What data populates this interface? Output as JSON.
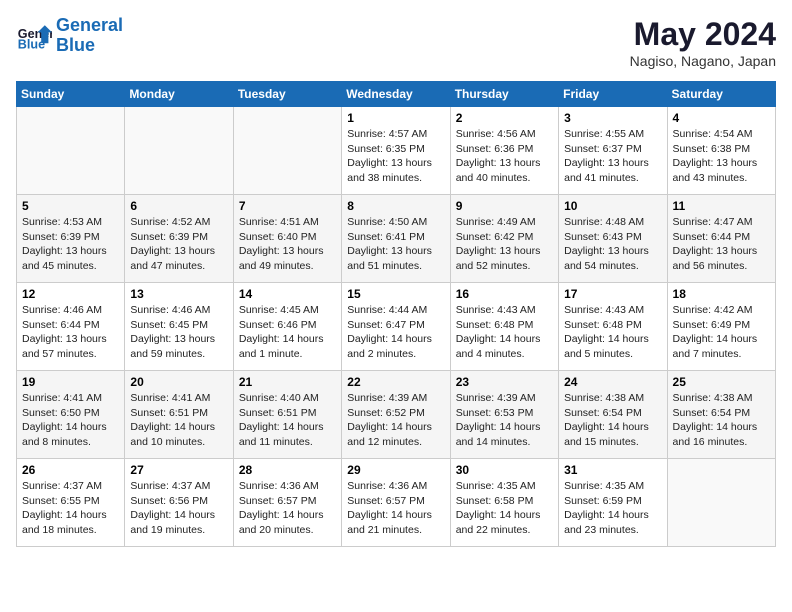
{
  "header": {
    "logo_general": "General",
    "logo_blue": "Blue",
    "month": "May 2024",
    "location": "Nagiso, Nagano, Japan"
  },
  "days_of_week": [
    "Sunday",
    "Monday",
    "Tuesday",
    "Wednesday",
    "Thursday",
    "Friday",
    "Saturday"
  ],
  "weeks": [
    [
      {
        "day": "",
        "info": ""
      },
      {
        "day": "",
        "info": ""
      },
      {
        "day": "",
        "info": ""
      },
      {
        "day": "1",
        "info": "Sunrise: 4:57 AM\nSunset: 6:35 PM\nDaylight: 13 hours\nand 38 minutes."
      },
      {
        "day": "2",
        "info": "Sunrise: 4:56 AM\nSunset: 6:36 PM\nDaylight: 13 hours\nand 40 minutes."
      },
      {
        "day": "3",
        "info": "Sunrise: 4:55 AM\nSunset: 6:37 PM\nDaylight: 13 hours\nand 41 minutes."
      },
      {
        "day": "4",
        "info": "Sunrise: 4:54 AM\nSunset: 6:38 PM\nDaylight: 13 hours\nand 43 minutes."
      }
    ],
    [
      {
        "day": "5",
        "info": "Sunrise: 4:53 AM\nSunset: 6:39 PM\nDaylight: 13 hours\nand 45 minutes."
      },
      {
        "day": "6",
        "info": "Sunrise: 4:52 AM\nSunset: 6:39 PM\nDaylight: 13 hours\nand 47 minutes."
      },
      {
        "day": "7",
        "info": "Sunrise: 4:51 AM\nSunset: 6:40 PM\nDaylight: 13 hours\nand 49 minutes."
      },
      {
        "day": "8",
        "info": "Sunrise: 4:50 AM\nSunset: 6:41 PM\nDaylight: 13 hours\nand 51 minutes."
      },
      {
        "day": "9",
        "info": "Sunrise: 4:49 AM\nSunset: 6:42 PM\nDaylight: 13 hours\nand 52 minutes."
      },
      {
        "day": "10",
        "info": "Sunrise: 4:48 AM\nSunset: 6:43 PM\nDaylight: 13 hours\nand 54 minutes."
      },
      {
        "day": "11",
        "info": "Sunrise: 4:47 AM\nSunset: 6:44 PM\nDaylight: 13 hours\nand 56 minutes."
      }
    ],
    [
      {
        "day": "12",
        "info": "Sunrise: 4:46 AM\nSunset: 6:44 PM\nDaylight: 13 hours\nand 57 minutes."
      },
      {
        "day": "13",
        "info": "Sunrise: 4:46 AM\nSunset: 6:45 PM\nDaylight: 13 hours\nand 59 minutes."
      },
      {
        "day": "14",
        "info": "Sunrise: 4:45 AM\nSunset: 6:46 PM\nDaylight: 14 hours\nand 1 minute."
      },
      {
        "day": "15",
        "info": "Sunrise: 4:44 AM\nSunset: 6:47 PM\nDaylight: 14 hours\nand 2 minutes."
      },
      {
        "day": "16",
        "info": "Sunrise: 4:43 AM\nSunset: 6:48 PM\nDaylight: 14 hours\nand 4 minutes."
      },
      {
        "day": "17",
        "info": "Sunrise: 4:43 AM\nSunset: 6:48 PM\nDaylight: 14 hours\nand 5 minutes."
      },
      {
        "day": "18",
        "info": "Sunrise: 4:42 AM\nSunset: 6:49 PM\nDaylight: 14 hours\nand 7 minutes."
      }
    ],
    [
      {
        "day": "19",
        "info": "Sunrise: 4:41 AM\nSunset: 6:50 PM\nDaylight: 14 hours\nand 8 minutes."
      },
      {
        "day": "20",
        "info": "Sunrise: 4:41 AM\nSunset: 6:51 PM\nDaylight: 14 hours\nand 10 minutes."
      },
      {
        "day": "21",
        "info": "Sunrise: 4:40 AM\nSunset: 6:51 PM\nDaylight: 14 hours\nand 11 minutes."
      },
      {
        "day": "22",
        "info": "Sunrise: 4:39 AM\nSunset: 6:52 PM\nDaylight: 14 hours\nand 12 minutes."
      },
      {
        "day": "23",
        "info": "Sunrise: 4:39 AM\nSunset: 6:53 PM\nDaylight: 14 hours\nand 14 minutes."
      },
      {
        "day": "24",
        "info": "Sunrise: 4:38 AM\nSunset: 6:54 PM\nDaylight: 14 hours\nand 15 minutes."
      },
      {
        "day": "25",
        "info": "Sunrise: 4:38 AM\nSunset: 6:54 PM\nDaylight: 14 hours\nand 16 minutes."
      }
    ],
    [
      {
        "day": "26",
        "info": "Sunrise: 4:37 AM\nSunset: 6:55 PM\nDaylight: 14 hours\nand 18 minutes."
      },
      {
        "day": "27",
        "info": "Sunrise: 4:37 AM\nSunset: 6:56 PM\nDaylight: 14 hours\nand 19 minutes."
      },
      {
        "day": "28",
        "info": "Sunrise: 4:36 AM\nSunset: 6:57 PM\nDaylight: 14 hours\nand 20 minutes."
      },
      {
        "day": "29",
        "info": "Sunrise: 4:36 AM\nSunset: 6:57 PM\nDaylight: 14 hours\nand 21 minutes."
      },
      {
        "day": "30",
        "info": "Sunrise: 4:35 AM\nSunset: 6:58 PM\nDaylight: 14 hours\nand 22 minutes."
      },
      {
        "day": "31",
        "info": "Sunrise: 4:35 AM\nSunset: 6:59 PM\nDaylight: 14 hours\nand 23 minutes."
      },
      {
        "day": "",
        "info": ""
      }
    ]
  ]
}
